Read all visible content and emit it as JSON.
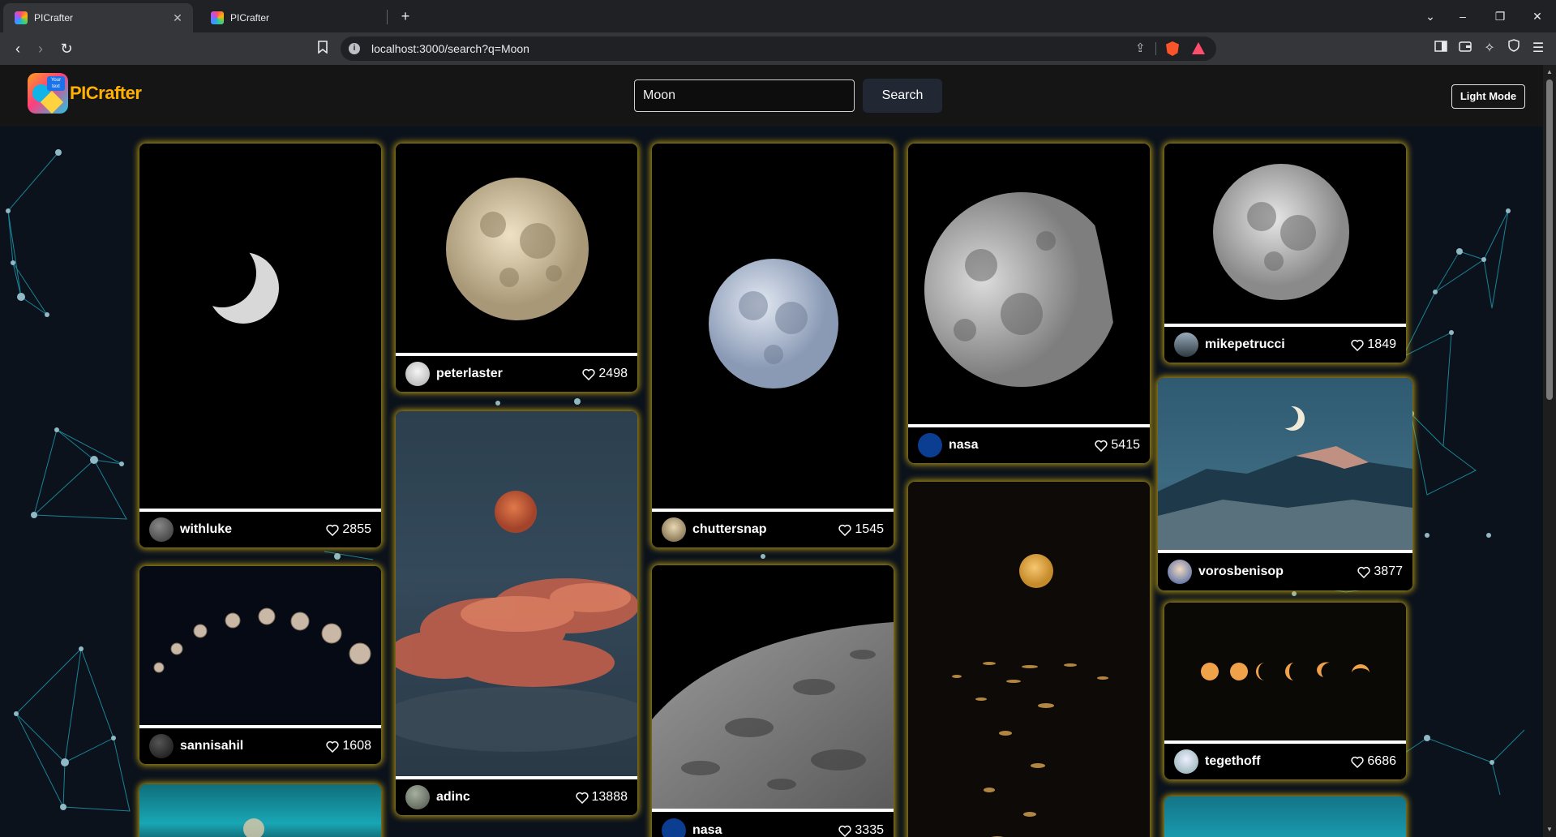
{
  "browser": {
    "tabs": [
      {
        "title": "PICrafter",
        "active": true
      },
      {
        "title": "PICrafter",
        "active": false
      }
    ],
    "url": "localhost:3000/search?q=Moon",
    "icons": [
      "back-icon",
      "forward-icon",
      "reload-icon",
      "bookmark-icon",
      "site-info-icon",
      "share-icon",
      "brave-shields-icon",
      "brave-rewards-icon",
      "sidebar-icon",
      "wallet-icon",
      "leo-ai-icon",
      "vpn-icon",
      "menu-icon"
    ]
  },
  "header": {
    "logo_badge": "Your text",
    "logo_text": "PICrafter",
    "search_value": "Moon",
    "search_button": "Search",
    "mode_button": "Light Mode"
  },
  "cards": [
    {
      "user": "withluke",
      "likes": "2855"
    },
    {
      "user": "sannisahil",
      "likes": "1608"
    },
    {
      "user": "peterlaster",
      "likes": "2498"
    },
    {
      "user": "adinc",
      "likes": "13888"
    },
    {
      "user": "chuttersnap",
      "likes": "1545"
    },
    {
      "user": "nasa",
      "likes": "3335"
    },
    {
      "user": "nasa",
      "likes": "5415"
    },
    {
      "user": "mikepetrucci",
      "likes": "1849"
    },
    {
      "user": "vorosbenisop",
      "likes": "3877"
    },
    {
      "user": "tegethoff",
      "likes": "6686"
    }
  ],
  "colors": {
    "accent_logo": "#ffb000",
    "card_glow": "#e6be14",
    "header_bg": "#151515",
    "page_bg": "#0b121b",
    "network_lines": "#1fa3b8"
  }
}
